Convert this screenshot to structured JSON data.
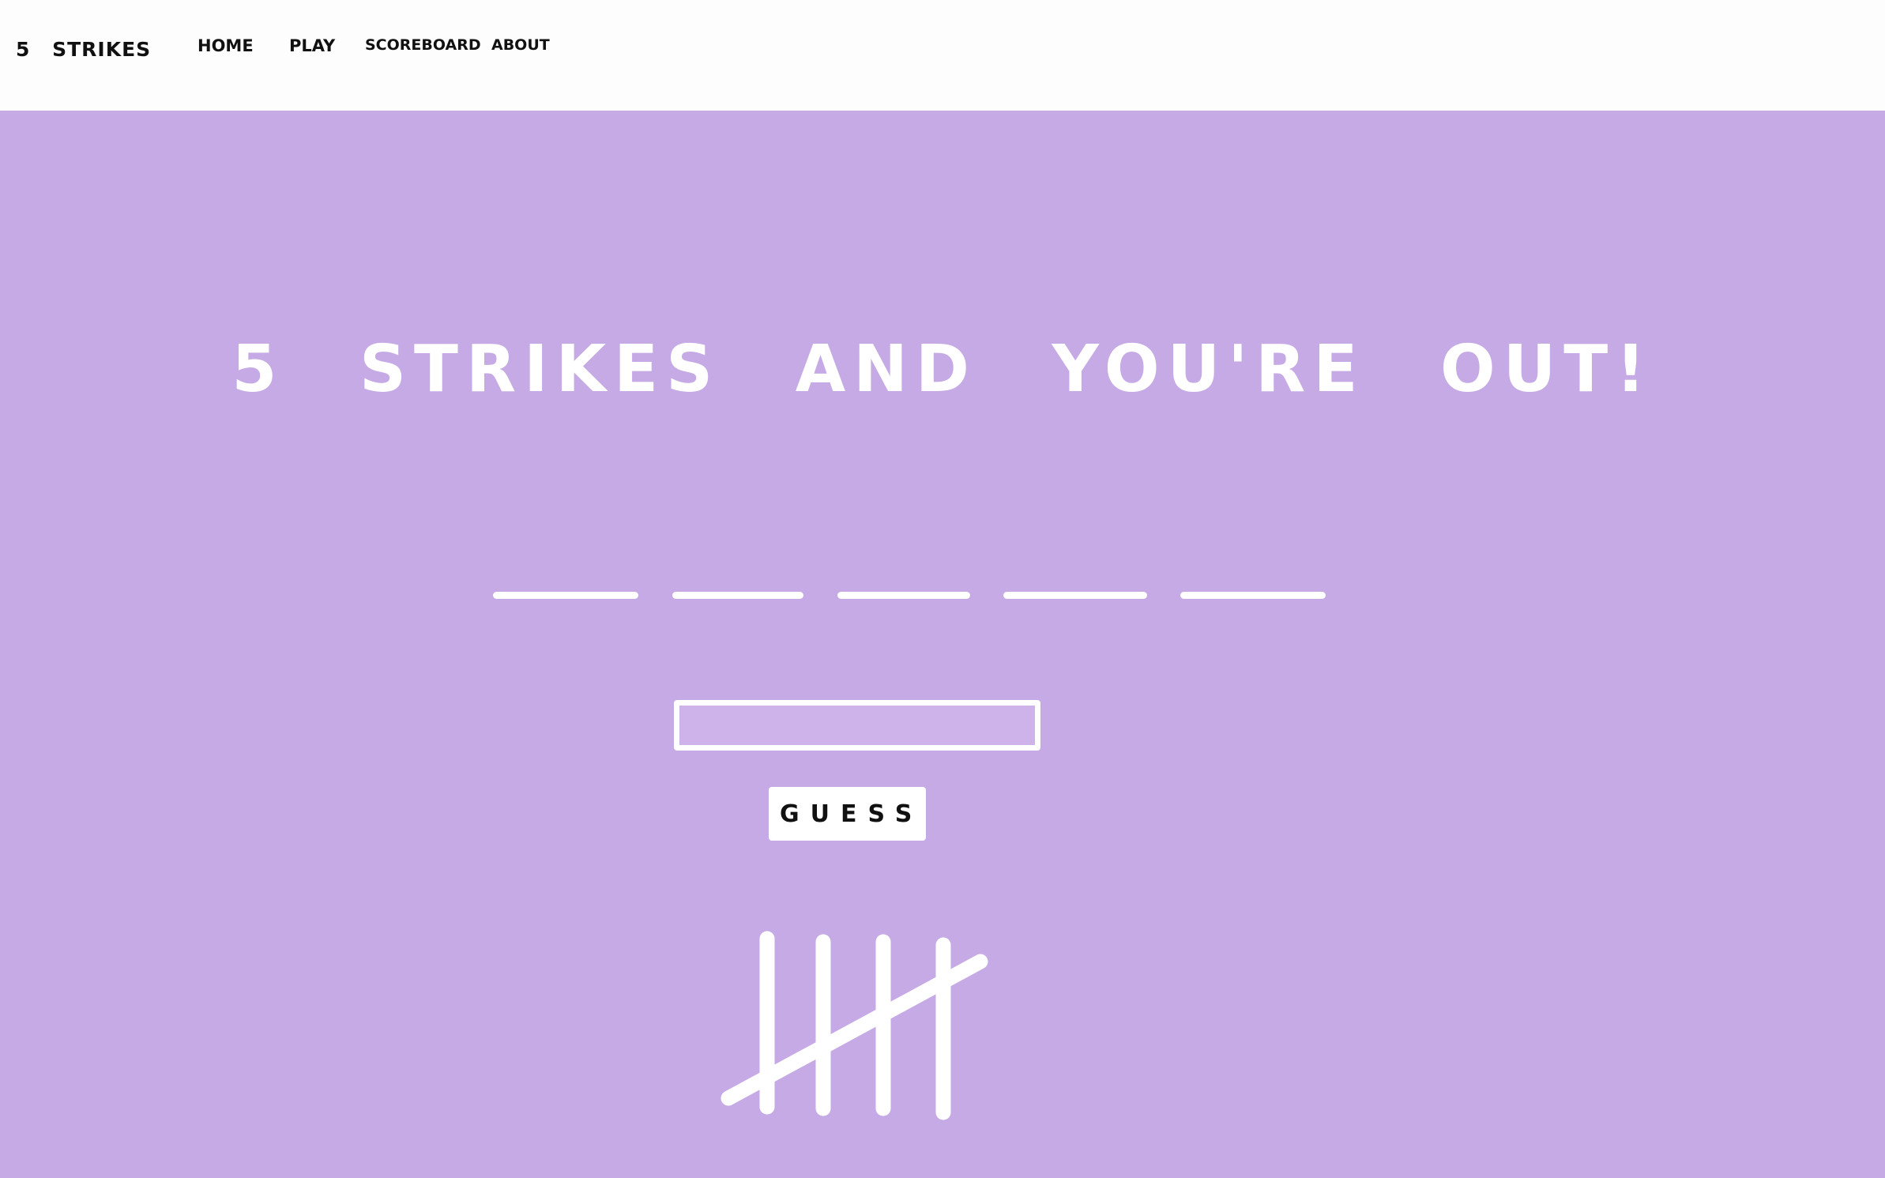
{
  "header": {
    "brand": "5 STRIKES",
    "nav": {
      "home": "HOME",
      "play": "PLAY",
      "scoreboard": "SCOREBOARD",
      "about": "ABOUT"
    }
  },
  "main": {
    "title": "5 STRIKES AND YOU'RE OUT!",
    "word_blanks": 5,
    "guess_input": {
      "value": "",
      "placeholder": ""
    },
    "guess_button": "GUESS",
    "strikes": 5
  },
  "colors": {
    "background": "#c5aae5",
    "header_bg": "#fdfdfd",
    "foreground": "#ffffff",
    "text_dark": "#111111"
  }
}
